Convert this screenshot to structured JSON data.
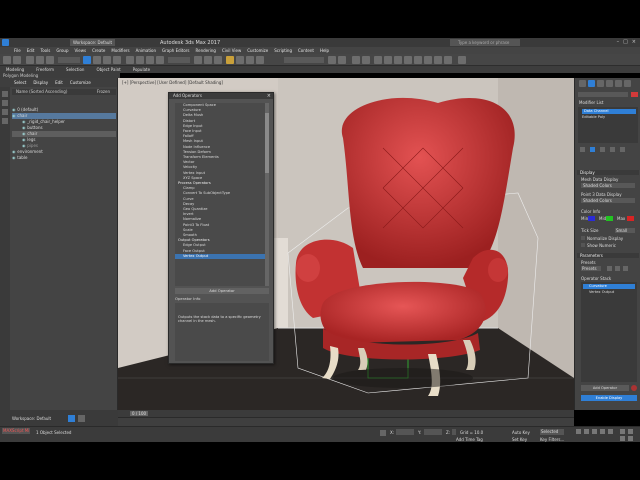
{
  "titlebar": {
    "title": "Autodesk 3ds Max 2017",
    "workspace": "Workspace: Default",
    "search_placeholder": "Type a keyword or phrase"
  },
  "menubar": [
    "File",
    "Edit",
    "Tools",
    "Group",
    "Views",
    "Create",
    "Modifiers",
    "Animation",
    "Graph Editors",
    "Rendering",
    "Civil View",
    "Customize",
    "Scripting",
    "Content",
    "Help"
  ],
  "ribbon": {
    "tabs": [
      "Modeling",
      "Freeform",
      "Selection",
      "Object Paint",
      "Populate"
    ],
    "sub": "Polygon Modeling"
  },
  "explorer": {
    "tabs": [
      "Select",
      "Display",
      "Edit",
      "Customize"
    ],
    "header_name": "Name (Sorted Ascending)",
    "header_prop": "Frozen",
    "rows": [
      {
        "label": "0 (default)",
        "state": "normal"
      },
      {
        "label": "chair",
        "state": "selected"
      },
      {
        "label": "_rigid_chair_helper",
        "state": "normal"
      },
      {
        "label": "buttons",
        "state": "normal"
      },
      {
        "label": "chair",
        "state": "highlight"
      },
      {
        "label": "legs",
        "state": "normal"
      },
      {
        "label": "pipes",
        "state": "normal"
      },
      {
        "label": "environment",
        "state": "normal"
      },
      {
        "label": "table",
        "state": "normal"
      }
    ]
  },
  "viewport": {
    "label": "[+] [Perspective] [User Defined] [Default Shading]"
  },
  "dialog": {
    "title": "Add Operators",
    "items": [
      {
        "label": "Component Space",
        "type": "item"
      },
      {
        "label": "Curvature",
        "type": "item"
      },
      {
        "label": "Delta Mush",
        "type": "item"
      },
      {
        "label": "Distort",
        "type": "item"
      },
      {
        "label": "Edge Input",
        "type": "item"
      },
      {
        "label": "Face Input",
        "type": "item"
      },
      {
        "label": "Falloff",
        "type": "item"
      },
      {
        "label": "Mesh Input",
        "type": "item"
      },
      {
        "label": "Node Influence",
        "type": "item"
      },
      {
        "label": "Tension Deform",
        "type": "item"
      },
      {
        "label": "Transform Elements",
        "type": "item"
      },
      {
        "label": "Vector",
        "type": "item"
      },
      {
        "label": "Velocity",
        "type": "item"
      },
      {
        "label": "Vertex Input",
        "type": "item"
      },
      {
        "label": "XYZ Space",
        "type": "item"
      },
      {
        "label": "Process Operators",
        "type": "category"
      },
      {
        "label": "Clamp",
        "type": "item"
      },
      {
        "label": "Convert To SubObjectType",
        "type": "item"
      },
      {
        "label": "Curve",
        "type": "item"
      },
      {
        "label": "Decay",
        "type": "item"
      },
      {
        "label": "Geo Quantize",
        "type": "item"
      },
      {
        "label": "Invert",
        "type": "item"
      },
      {
        "label": "Normalize",
        "type": "item"
      },
      {
        "label": "Point3 To Float",
        "type": "item"
      },
      {
        "label": "Scale",
        "type": "item"
      },
      {
        "label": "Smooth",
        "type": "item"
      },
      {
        "label": "Output Operators",
        "type": "category"
      },
      {
        "label": "Edge Output",
        "type": "item"
      },
      {
        "label": "Face Output",
        "type": "item"
      },
      {
        "label": "Vertex Output",
        "type": "selected"
      }
    ],
    "add_button": "Add Operator",
    "info_header": "Operator Info",
    "info_text": "Outputs the stack data to a specific geometry channel in the mesh."
  },
  "cmdpanel": {
    "object_name": "Data Channel",
    "modifier_list": "Modifier List",
    "stack_items": [
      "Data Channel",
      "Editable Poly"
    ],
    "display_section": "Display",
    "mesh_data_label": "Mesh Data Display",
    "mesh_data_value": "Shaded Colors",
    "point3_label": "Point 3 Data Display",
    "point3_value": "Shaded Colors",
    "color_info_label": "Color Info",
    "min_label": "Min",
    "mid_label": "Mid",
    "max_label": "Max",
    "tick_size_label": "Tick Size",
    "tick_size_value": "Small",
    "normalize_label": "Normalize Display",
    "show_numeric_label": "Show Numeric",
    "params_section": "Parameters",
    "presets_label": "Presets",
    "presets_value": "Presets",
    "operator_stack_label": "Operator Stack",
    "operator_stack_items": [
      "Curvature",
      "Vertex Output"
    ],
    "add_operator_btn": "Add Operator",
    "enable_display_btn": "Enable Display",
    "curvature_section": "Curvature"
  },
  "status": {
    "workspace_bottom": "Workspace: Default",
    "selected": "1 Object Selected",
    "script_label": "MAXScript Mi",
    "grid": "Grid = 10.0",
    "add_time_tag": "Add Time Tag",
    "auto_key": "Auto Key",
    "set_key": "Set Key",
    "selected_dropdown": "Selected",
    "key_filters": "Key Filters...",
    "frame_counter": "0 / 100",
    "x_label": "X:",
    "y_label": "Y:",
    "z_label": "Z:"
  },
  "colors": {
    "accent": "#2f7fd6",
    "chair_red": "#d23a3a",
    "min_color": "#2b2bd8",
    "mid_color": "#22c322",
    "max_color": "#d82424"
  }
}
